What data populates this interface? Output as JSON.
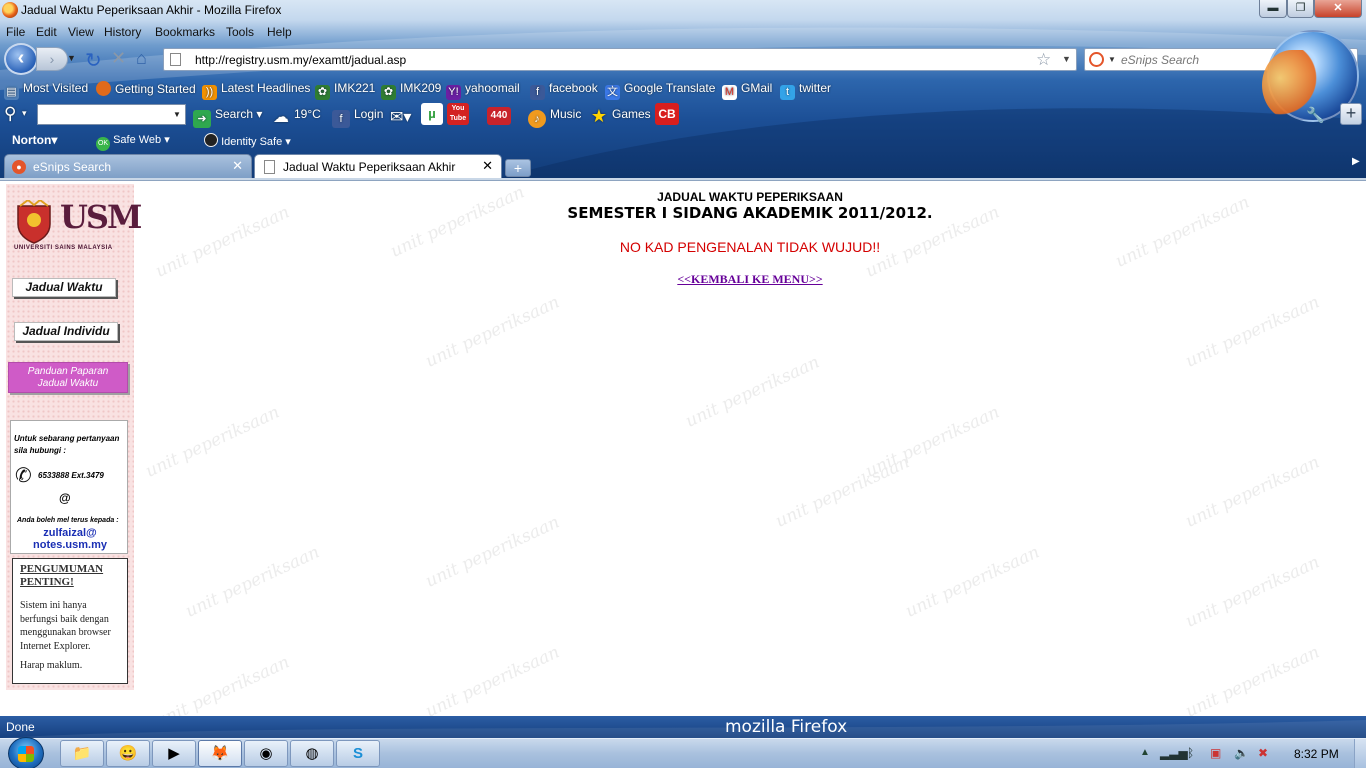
{
  "window": {
    "title": "Jadual Waktu Peperiksaan Akhir - Mozilla Firefox",
    "min_label": "▬",
    "max_label": "❐",
    "close_label": "✕"
  },
  "menu": [
    "File",
    "Edit",
    "View",
    "History",
    "Bookmarks",
    "Tools",
    "Help"
  ],
  "nav": {
    "url": "http://registry.usm.my/examtt/jadual.asp",
    "search_placeholder": "eSnips Search"
  },
  "bookmarks": [
    {
      "label": "Most Visited",
      "icon": "most-visited-icon",
      "color": "#4f7fb8"
    },
    {
      "label": "Getting Started",
      "icon": "firefox-icon",
      "color": "#e06a1b"
    },
    {
      "label": "Latest Headlines",
      "icon": "rss-icon",
      "color": "#f29100"
    },
    {
      "label": "IMK221",
      "icon": "plant-icon",
      "color": "#2f7d32"
    },
    {
      "label": "IMK209",
      "icon": "plant-icon",
      "color": "#2f7d32"
    },
    {
      "label": "yahoomail",
      "icon": "yahoo-icon",
      "color": "#6b1fa3"
    },
    {
      "label": "facebook",
      "icon": "facebook-icon",
      "color": "#3b5998"
    },
    {
      "label": "Google Translate",
      "icon": "translate-icon",
      "color": "#3b78e7"
    },
    {
      "label": "GMail",
      "icon": "gmail-icon",
      "color": "#d93025"
    },
    {
      "label": "twitter",
      "icon": "twitter-icon",
      "color": "#33a3e8"
    }
  ],
  "toolbar": {
    "search_label": "Search",
    "weather": "19°C",
    "login_label": "Login",
    "badge_440": "440",
    "music_label": "Music",
    "games_label": "Games",
    "cb_label": "CB",
    "youtube_label": "You Tube"
  },
  "norton": {
    "brand": "Norton",
    "safe_web": "Safe Web",
    "identity_safe": "Identity Safe"
  },
  "tabs": [
    {
      "label": "eSnips Search",
      "active": false
    },
    {
      "label": "Jadual Waktu Peperiksaan Akhir",
      "active": true
    }
  ],
  "sidebar": {
    "logo_text": "USM",
    "logo_sub": "UNIVERSITI SAINS MALAYSIA",
    "btn_jadual_waktu": "Jadual Waktu",
    "btn_jadual_individu": "Jadual Individu",
    "btn_panduan_line1": "Panduan Paparan",
    "btn_panduan_line2": "Jadual Waktu",
    "contact_intro": "Untuk sebarang pertanyaan sila hubungi :",
    "phone": "6533888 Ext.3479",
    "at": "@",
    "email_intro": "Anda boleh mel terus kepada :",
    "email_line1": "zulfaizal@",
    "email_line2": "notes.usm.my",
    "notice_title": "PENGUMUMAN PENTING!",
    "notice_body": "Sistem ini hanya berfungsi baik dengan menggunakan browser Internet Explorer.",
    "notice_end": "Harap maklum."
  },
  "main": {
    "heading": "JADUAL WAKTU PEPERIKSAAN",
    "subheading": "SEMESTER I SIDANG AKADEMIK 2011/2012.",
    "error": "NO KAD PENGENALAN TIDAK WUJUD!!",
    "back_link": "<<KEMBALI KE MENU>>",
    "watermark": "unit peperiksaan"
  },
  "status": {
    "text": "Done",
    "brand_pre": "mozilla",
    "brand_post": "Firefox"
  },
  "taskbar": {
    "apps": [
      {
        "icon": "file-explorer-icon",
        "glyph": "📁"
      },
      {
        "icon": "messenger-icon",
        "glyph": "😀"
      },
      {
        "icon": "media-player-icon",
        "glyph": "▶"
      },
      {
        "icon": "firefox-icon",
        "glyph": "🦊"
      },
      {
        "icon": "chrome-icon",
        "glyph": "◉"
      },
      {
        "icon": "network-icon",
        "glyph": "◍"
      },
      {
        "icon": "skype-icon",
        "glyph": "S"
      }
    ],
    "clock": "8:32 PM"
  }
}
